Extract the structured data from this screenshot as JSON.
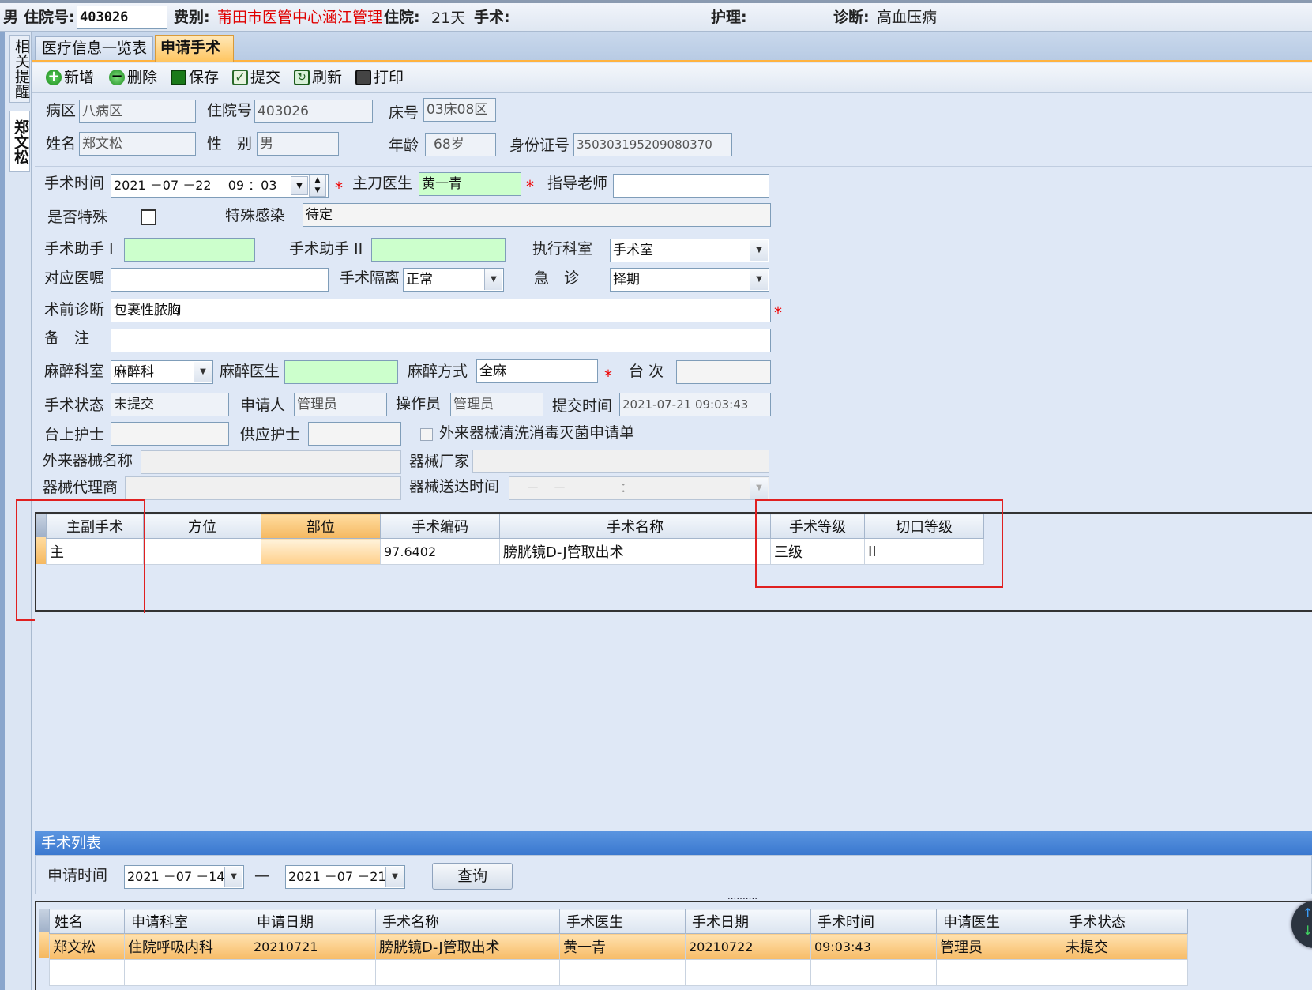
{
  "header": {
    "gender": "男",
    "admission_no_label": "住院号:",
    "admission_no": "403026",
    "fee_type_label": "费别:",
    "fee_type": "莆田市医管中心涵江管理部",
    "stay_label": "住院:",
    "stay_days": "21天",
    "surgery_label": "手术:",
    "nursing_label": "护理:",
    "diagnosis_label": "诊断:",
    "diagnosis": "高血压病"
  },
  "side_tabs": {
    "reminder": "相关提醒",
    "patient": "郑文松"
  },
  "tabs": [
    {
      "label": "医疗信息一览表"
    },
    {
      "label": "申请手术"
    }
  ],
  "toolbar": {
    "add": "新增",
    "delete": "删除",
    "save": "保存",
    "submit": "提交",
    "refresh": "刷新",
    "print": "打印"
  },
  "patient": {
    "ward_label": "病区",
    "ward": "八病区",
    "admission_label": "住院号",
    "admission": "403026",
    "bed_label": "床号",
    "bed": "03床08区",
    "name_label": "姓名",
    "name": "郑文松",
    "sex_label": "性　别",
    "sex": "男",
    "age_label": "年龄",
    "age": "68岁",
    "id_label": "身份证号",
    "id": "350303195209080370"
  },
  "form": {
    "surgery_time_label": "手术时间",
    "surgery_time": "2021 －07 －22　 09 ：03",
    "surgeon_label": "主刀医生",
    "surgeon": "黄一青",
    "mentor_label": "指导老师",
    "special_label": "是否特殊",
    "infection_label": "特殊感染",
    "infection": "待定",
    "assistant1_label": "手术助手 I",
    "assistant2_label": "手术助手 II",
    "exec_dept_label": "执行科室",
    "exec_dept": "手术室",
    "order_label": "对应医嘱",
    "isolation_label": "手术隔离",
    "isolation": "正常",
    "emergency_label": "急　诊",
    "emergency": "择期",
    "pre_diag_label": "术前诊断",
    "pre_diag": "包裹性脓胸",
    "remark_label": "备　注",
    "anes_dept_label": "麻醉科室",
    "anes_dept": "麻醉科",
    "anes_doctor_label": "麻醉医生",
    "anes_method_label": "麻醉方式",
    "anes_method": "全麻",
    "table_no_label": "台 次",
    "status_label": "手术状态",
    "status": "未提交",
    "applicant_label": "申请人",
    "applicant": "管理员",
    "operator_label": "操作员",
    "operator": "管理员",
    "submit_time_label": "提交时间",
    "submit_time": "2021-07-21 09:03:43",
    "scrub_nurse_label": "台上护士",
    "supply_nurse_label": "供应护士",
    "external_label": "外来器械清洗消毒灭菌申请单",
    "ext_name_label": "外来器械名称",
    "ext_maker_label": "器械厂家",
    "ext_agent_label": "器械代理商",
    "ext_time_label": "器械送达时间",
    "ext_time": "－　－　　　　：　"
  },
  "surgery_grid": {
    "headers": [
      "主副手术",
      "方位",
      "部位",
      "手术编码",
      "手术名称",
      "手术等级",
      "切口等级"
    ],
    "rows": [
      [
        "主",
        "",
        "",
        "97.6402",
        "膀胱镜D-J管取出术",
        "三级",
        "II"
      ]
    ]
  },
  "surgery_list": {
    "title": "手术列表",
    "apply_time_label": "申请时间",
    "date_from": "2021 －07 －14",
    "separator": "—",
    "date_to": "2021 －07 －21",
    "query_button": "查询",
    "dots": "..........",
    "headers": [
      "姓名",
      "申请科室",
      "申请日期",
      "手术名称",
      "手术医生",
      "手术日期",
      "手术时间",
      "申请医生",
      "手术状态"
    ],
    "rows": [
      [
        "郑文松",
        "住院呼吸内科",
        "20210721",
        "膀胱镜D-J管取出术",
        "黄一青",
        "20210722",
        "09:03:43",
        "管理员",
        "未提交"
      ]
    ]
  },
  "colors": {
    "accent_blue": "#3b7fd9",
    "required_star": "#e00000",
    "highlight_orange": "#f7bb66",
    "green_field": "#ccffcc"
  }
}
